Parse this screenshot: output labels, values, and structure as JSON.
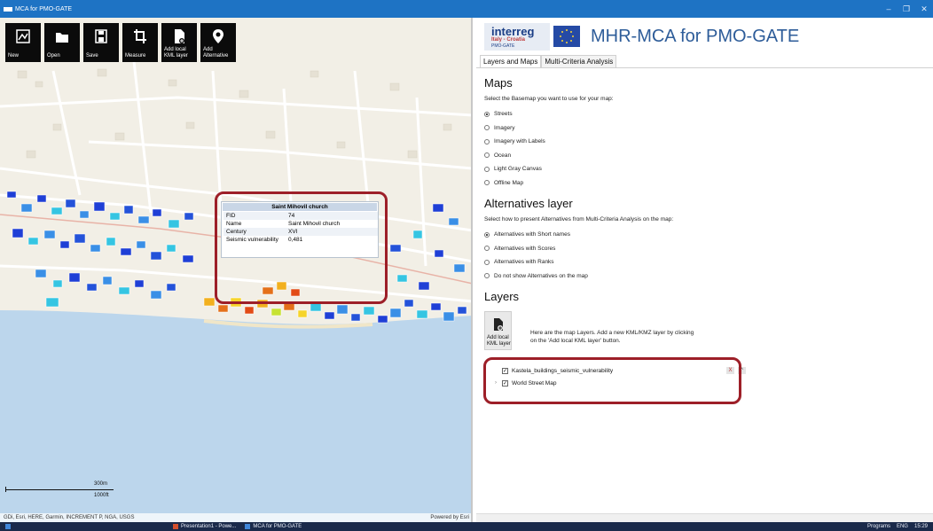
{
  "window": {
    "title": "MCA for PMO-GATE",
    "controls": [
      "–",
      "❐",
      "✕"
    ]
  },
  "toolbar": [
    {
      "id": "new",
      "label": "New",
      "icon": "new-map-icon"
    },
    {
      "id": "open",
      "label": "Open",
      "icon": "folder-icon"
    },
    {
      "id": "save",
      "label": "Save",
      "icon": "save-icon"
    },
    {
      "id": "measure",
      "label": "Measure",
      "icon": "crop-icon"
    },
    {
      "id": "add-kml",
      "label": "Add local KML layer",
      "icon": "file-add-icon"
    },
    {
      "id": "add-alt",
      "label": "Add Alternative",
      "icon": "map-pin-icon"
    }
  ],
  "popup": {
    "title": "Saint Mihovil church",
    "rows": [
      {
        "key": "FID",
        "value": "74"
      },
      {
        "key": "Name",
        "value": "Saint Mihovil church"
      },
      {
        "key": "Century",
        "value": "XVI"
      },
      {
        "key": "Seismic vulnerability",
        "value": "0,481"
      }
    ]
  },
  "scalebar": {
    "metric": "300m",
    "imperial": "1000ft"
  },
  "attribution": {
    "left": "GDi, Esri, HERE, Garmin, INCREMENT P, NGA, USGS",
    "right": "Powered by Esri"
  },
  "header": {
    "logo_text": "interreg",
    "logo_sub": "Italy - Croatia",
    "logo_sub2": "PMO-GATE",
    "app_title": "MHR-MCA for PMO-GATE"
  },
  "tabs": [
    "Layers and Maps",
    "Multi-Criteria Analysis"
  ],
  "maps": {
    "heading": "Maps",
    "description": "Select the Basemap you want to use for your map:",
    "options": [
      "Streets",
      "Imagery",
      "Imagery with Labels",
      "Ocean",
      "Light Gray Canvas",
      "Offline Map"
    ],
    "selected": 0
  },
  "alternatives": {
    "heading": "Alternatives layer",
    "description": "Select how to present Alternatives from Multi-Criteria Analysis on the map:",
    "options": [
      "Alternatives with Short names",
      "Alternatives with Scores",
      "Alternatives with Ranks",
      "Do not show Alternatives on the map"
    ],
    "selected": 0
  },
  "layers": {
    "heading": "Layers",
    "button_label": "Add local KML layer",
    "description_line1": "Here are the map Layers. Add a new KML/KMZ layer by clicking",
    "description_line2": "on the 'Add local KML layer' button.",
    "items": [
      {
        "name": "Kastela_buildings_seismic_vulnerability",
        "checked": true
      },
      {
        "name": "World Street Map",
        "checked": true
      }
    ]
  },
  "taskbar": {
    "items": [
      "Presentation1 - Powe...",
      "MCA for PMO-GATE"
    ],
    "tray": [
      "Programs",
      "ENG",
      "15:29"
    ]
  }
}
